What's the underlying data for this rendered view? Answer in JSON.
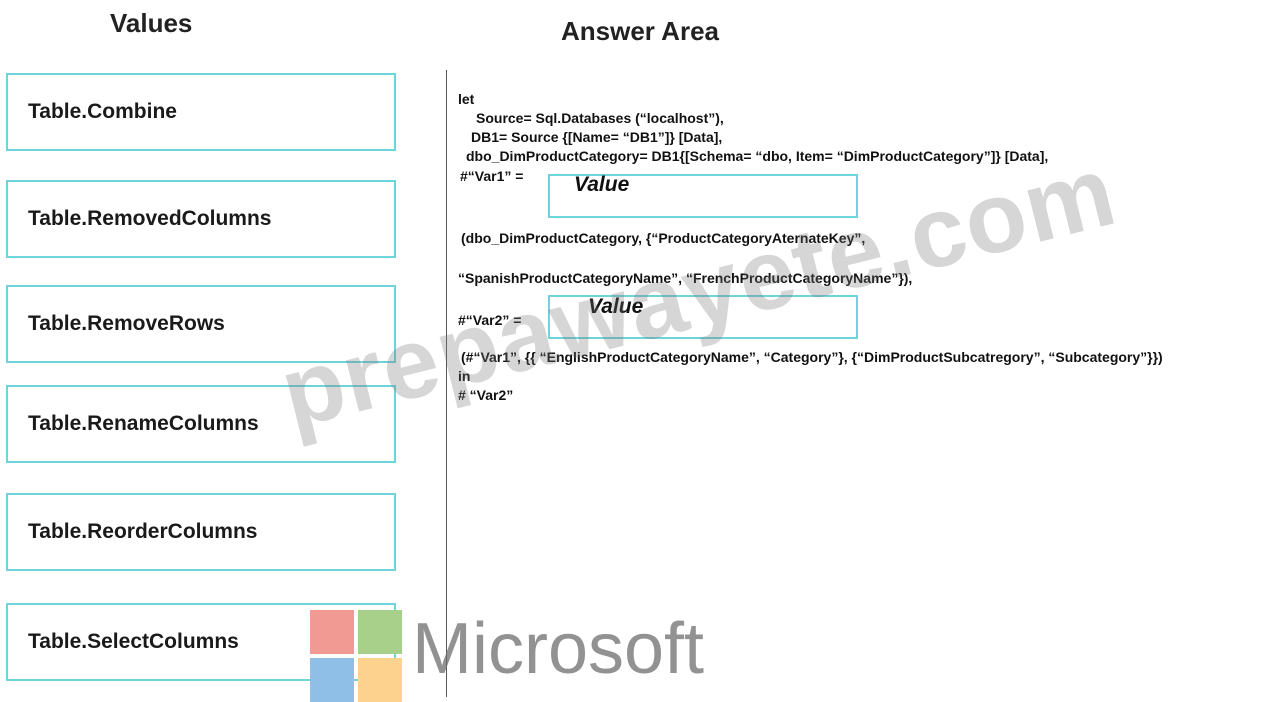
{
  "headings": {
    "values": "Values",
    "answer_area": "Answer Area"
  },
  "values": [
    "Table.Combine",
    "Table.RemovedColumns",
    "Table.RemoveRows",
    "Table.RenameColumns",
    "Table.ReorderColumns",
    "Table.SelectColumns"
  ],
  "code": {
    "line1": "let",
    "line2": "Source= Sql.Databases (“localhost”),",
    "line3": "DB1= Source {[Name= “DB1”]} [Data],",
    "line4": "dbo_DimProductCategory= DB1{[Schema= “dbo, Item= “DimProductCategory”]} [Data],",
    "var1_label": "#“Var1” =",
    "line6": "(dbo_DimProductCategory, {“ProductCategoryAternateKey”,",
    "line7": "“SpanishProductCategoryName”, “FrenchProductCategoryName”}),",
    "var2_label": "#“Var2” =",
    "line9": "(#“Var1”, {{ “EnglishProductCategoryName”, “Category”}, {“DimProductSubcatregory”, “Subcategory”}})",
    "line10": "in",
    "line11": "# “Var2”"
  },
  "drop_targets": {
    "var1_placeholder": "Value",
    "var2_placeholder": "Value"
  },
  "watermark": "prepawayete.com",
  "logo": {
    "wordmark": "Microsoft",
    "colors": [
      "#f09a93",
      "#a8d08a",
      "#8fbfe6",
      "#fcd28e"
    ]
  }
}
